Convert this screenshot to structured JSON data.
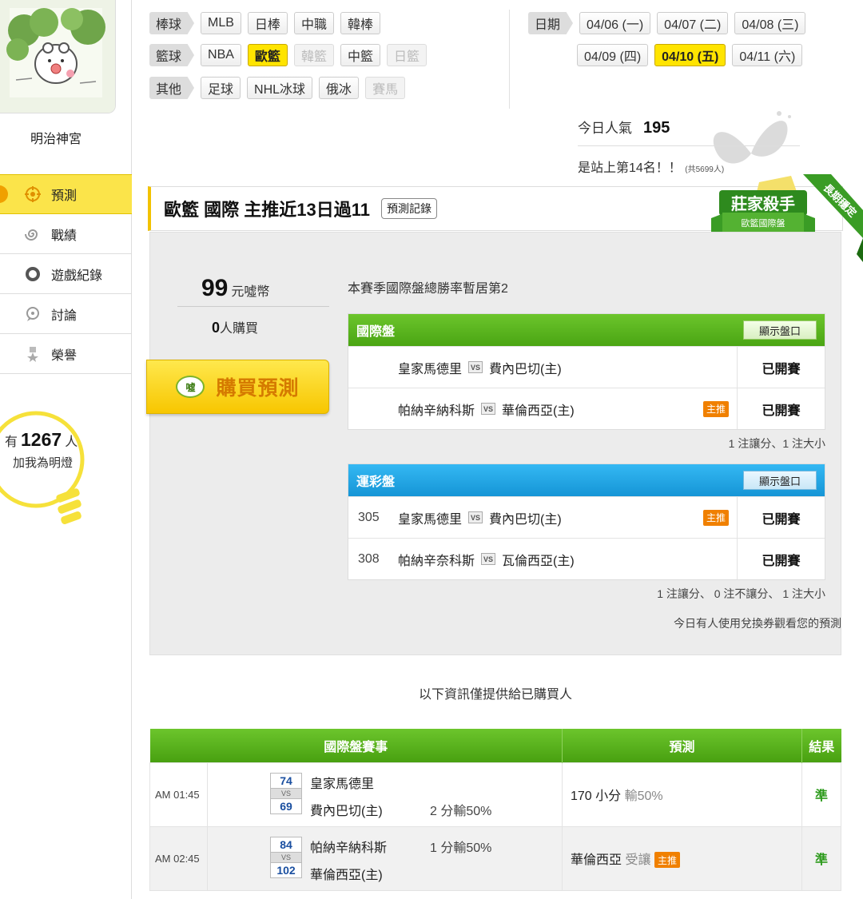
{
  "sidebar": {
    "username": "明治神宮",
    "items": [
      {
        "label": "預測",
        "icon": "target-icon"
      },
      {
        "label": "戰績",
        "icon": "spiral-icon"
      },
      {
        "label": "遊戲紀錄",
        "icon": "ring-icon"
      },
      {
        "label": "討論",
        "icon": "chat-icon"
      },
      {
        "label": "榮譽",
        "icon": "medal-icon"
      }
    ],
    "lamp_prefix": "有",
    "lamp_count": "1267",
    "lamp_suffix": "人",
    "lamp_text": "加我為明燈"
  },
  "nav": {
    "baseball": {
      "cat": "棒球",
      "items": [
        "MLB",
        "日棒",
        "中職",
        "韓棒"
      ]
    },
    "basketball": {
      "cat": "籃球",
      "items": [
        "NBA",
        "歐籃",
        "韓籃",
        "中籃",
        "日籃"
      ]
    },
    "other": {
      "cat": "其他",
      "items": [
        "足球",
        "NHL冰球",
        "俄冰",
        "賽馬"
      ]
    },
    "date_cat": "日期",
    "dates_row1": [
      "04/06 (一)",
      "04/07 (二)",
      "04/08 (三)"
    ],
    "dates_row2": [
      "04/09 (四)",
      "04/10 (五)",
      "04/11 (六)"
    ]
  },
  "stats": {
    "popularity_label": "今日人氣",
    "popularity_value": "195",
    "rank_text": "是站上第14名！！",
    "rank_total": "(共5699人)"
  },
  "panel": {
    "title": "歐籃 國際 主推近13日過11",
    "record_btn": "預測記錄",
    "badge_title": "莊家殺手",
    "badge_sub": "歐籃國際盤",
    "badge_ribbon": "長期穩定",
    "price_value": "99",
    "price_unit": "元噓幣",
    "buyers_value": "0",
    "buyers_unit": "人購買",
    "buy_btn": "購買預測",
    "buy_coin": "噓",
    "season_text": "本賽季國際盤總勝率暫居第2"
  },
  "intl": {
    "header": "國際盤",
    "show_btn": "顯示盤口",
    "rows": [
      {
        "code": "",
        "home": "皇家馬德里",
        "away": "費內巴切(主)",
        "tag": "",
        "status": "已開賽"
      },
      {
        "code": "",
        "home": "帕納辛納科斯",
        "away": "華倫西亞(主)",
        "tag": "主推",
        "status": "已開賽"
      }
    ],
    "note": "1 注讓分、1 注大小"
  },
  "lottery": {
    "header": "運彩盤",
    "show_btn": "顯示盤口",
    "rows": [
      {
        "code": "305",
        "home": "皇家馬德里",
        "away": "費內巴切(主)",
        "tag": "主推",
        "status": "已開賽"
      },
      {
        "code": "308",
        "home": "帕納辛奈科斯",
        "away": "瓦倫西亞(主)",
        "tag": "",
        "status": "已開賽"
      }
    ],
    "note": "1 注讓分、 0 注不讓分、 1 注大小",
    "note2": "今日有人使用兌換券觀看您的預測"
  },
  "info_msg": "以下資訊僅提供給已購買人",
  "results": {
    "headers": [
      "國際盤賽事",
      "預測",
      "結果"
    ],
    "vs": "VS",
    "rows": [
      {
        "time": "AM 01:45",
        "score1": "74",
        "score2": "69",
        "team1": "皇家馬德里",
        "team2": "費內巴切(主)",
        "odds": "2 分輸50%",
        "pred": "170 小分",
        "pred_extra": "輸50%",
        "tag": "",
        "result": "準"
      },
      {
        "time": "AM 02:45",
        "score1": "84",
        "score2": "102",
        "team1": "帕納辛納科斯",
        "team2": "華倫西亞(主)",
        "odds": "1 分輸50%",
        "pred": "華倫西亞",
        "pred_extra": "受讓",
        "tag": "主推",
        "result": "準"
      }
    ]
  },
  "colors": {
    "accent_yellow": "#ffe400",
    "green": "#4aa513",
    "blue": "#1595d6",
    "orange_tag": "#f08000"
  }
}
